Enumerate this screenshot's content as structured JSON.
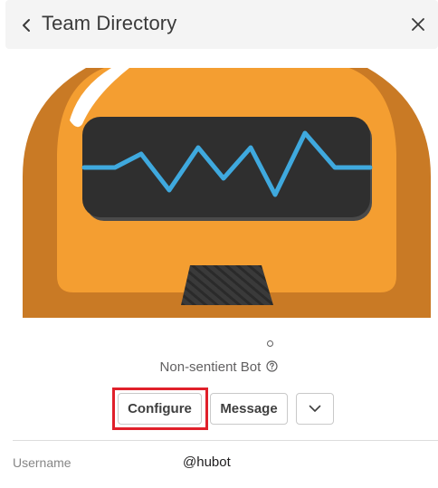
{
  "header": {
    "title": "Team Directory",
    "back_icon": "chevron-left-icon",
    "close_icon": "close-icon"
  },
  "profile": {
    "avatar": "hubot-robot-avatar",
    "presence": "away",
    "title": "Non-sentient Bot",
    "help_icon": "help-circle-icon"
  },
  "actions": {
    "configure_label": "Configure",
    "message_label": "Message",
    "more_icon": "chevron-down-icon"
  },
  "fields": {
    "username_label": "Username",
    "username_value": "@hubot"
  },
  "colors": {
    "robot_orange": "#f49e31",
    "robot_dark_orange": "#c97a25",
    "visor": "#2f2f2f",
    "wave": "#3fa9de",
    "highlight": "#e0202a"
  }
}
